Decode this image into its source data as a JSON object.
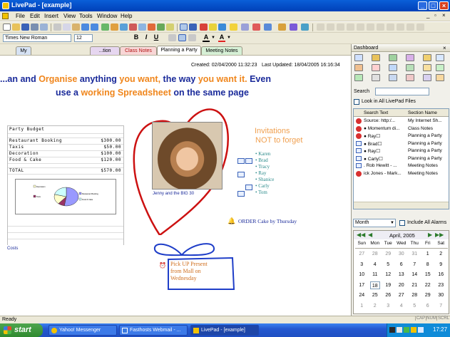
{
  "window": {
    "title": "LivePad - [example]"
  },
  "menu": [
    "File",
    "Edit",
    "Insert",
    "View",
    "Tools",
    "Window",
    "Help"
  ],
  "format_bar": {
    "font": "Times New Roman",
    "size": "12"
  },
  "tabs": [
    {
      "label": "My"
    },
    {
      "label": "...tion"
    },
    {
      "label": "Class Notes"
    },
    {
      "label": "Planning a Party"
    },
    {
      "label": "Meeting Notes"
    }
  ],
  "doc": {
    "created": "Created: 02/04/2000 11:32:23",
    "updated": "Last Updated: 18/04/2005 16:16:34",
    "headline_1": {
      "a": "...an and ",
      "b": "Organise",
      "c": " anything ",
      "d": "you want,",
      "e": " the way ",
      "f": "you want it.",
      "g": " Even"
    },
    "headline_2": {
      "a": "use a ",
      "b": "working Spreadsheet",
      "c": " on the same page"
    },
    "budget": {
      "title": "Party Budget",
      "rows": [
        {
          "label": "Restaurant Booking",
          "value": "$300.00"
        },
        {
          "label": "Taxis",
          "value": "$50.00"
        },
        {
          "label": "Decoration",
          "value": "$100.00"
        },
        {
          "label": "Food & Cake",
          "value": "$120.00"
        }
      ],
      "total_label": "TOTAL",
      "total_value": "$570.00"
    },
    "costs_label": "Costs",
    "photo_caption": "Jenny and the BIG 30",
    "invitations": {
      "line1": "Invitations",
      "line2": "NOT to forget"
    },
    "guests": [
      "Karen",
      "Brad",
      "Tracy",
      "Ray",
      "Shanice",
      "Carly",
      "Tom"
    ],
    "order_note": "ORDER Cake by Thursday",
    "present_note": {
      "l1": "Pick UP Present",
      "l2": "from Mall on",
      "l3": "Wednesday"
    }
  },
  "chart_data": {
    "type": "pie",
    "categories": [
      "Restaurant Booking",
      "Taxis",
      "Decoration",
      "Food & Cake"
    ],
    "values": [
      300,
      50,
      100,
      120
    ],
    "colors": [
      "#9999ff",
      "#993366",
      "#ffffcc",
      "#ccffff"
    ],
    "title": "",
    "legend": "right"
  },
  "dashboard": {
    "title": "Dashboard",
    "search_label": "Search",
    "search_value": "",
    "look_all_label": "Look in All LivePad Files",
    "col_text": "Search Text",
    "col_section": "Section Name",
    "results": [
      {
        "icon": "red",
        "text": "Source: http:/...",
        "section": "My Internet Sh..."
      },
      {
        "icon": "red",
        "text": "● Momentum di...",
        "section": "Class Notes"
      },
      {
        "icon": "red",
        "text": "● Ray☐",
        "section": "Planning a Party"
      },
      {
        "icon": "note",
        "text": "● Brad☐",
        "section": "Planning a Party"
      },
      {
        "icon": "note",
        "text": "● Ray☐",
        "section": "Planning a Party"
      },
      {
        "icon": "note",
        "text": "● Carly☐",
        "section": "Planning a Party"
      },
      {
        "icon": "note",
        "text": ". Rob Hewitt - ...",
        "section": "Meeting Notes"
      },
      {
        "icon": "red",
        "text": "ick Jones - Mark...",
        "section": "Meeting Notes"
      }
    ],
    "view_select": "Month",
    "alarms_label": "Include All Alarms",
    "calendar": {
      "month": "April, 2005",
      "days": [
        "Sun",
        "Mon",
        "Tue",
        "Wed",
        "Thu",
        "Fri",
        "Sat"
      ],
      "weeks": [
        [
          "27",
          "28",
          "29",
          "30",
          "31",
          "1",
          "2"
        ],
        [
          "3",
          "4",
          "5",
          "6",
          "7",
          "8",
          "9"
        ],
        [
          "10",
          "11",
          "12",
          "13",
          "14",
          "15",
          "16"
        ],
        [
          "17",
          "18",
          "19",
          "20",
          "21",
          "22",
          "23"
        ],
        [
          "24",
          "25",
          "26",
          "27",
          "28",
          "29",
          "30"
        ],
        [
          "1",
          "2",
          "3",
          "4",
          "5",
          "6",
          "7"
        ]
      ],
      "today": "18"
    }
  },
  "status": {
    "text": "Ready",
    "indicators": [
      "CAP",
      "NUM",
      "SCRL"
    ]
  },
  "taskbar": {
    "start": "start",
    "tasks": [
      "Yahoo! Messenger",
      "Fasthosts Webmail - ...",
      "LivePad - [example]"
    ],
    "clock": "17:27"
  },
  "colors": {
    "title": "#0a5fd8",
    "orange": "#f0861c",
    "navy": "#1a2a9a",
    "heart": "#cc1111",
    "pen_blue": "#1f3ec8"
  }
}
